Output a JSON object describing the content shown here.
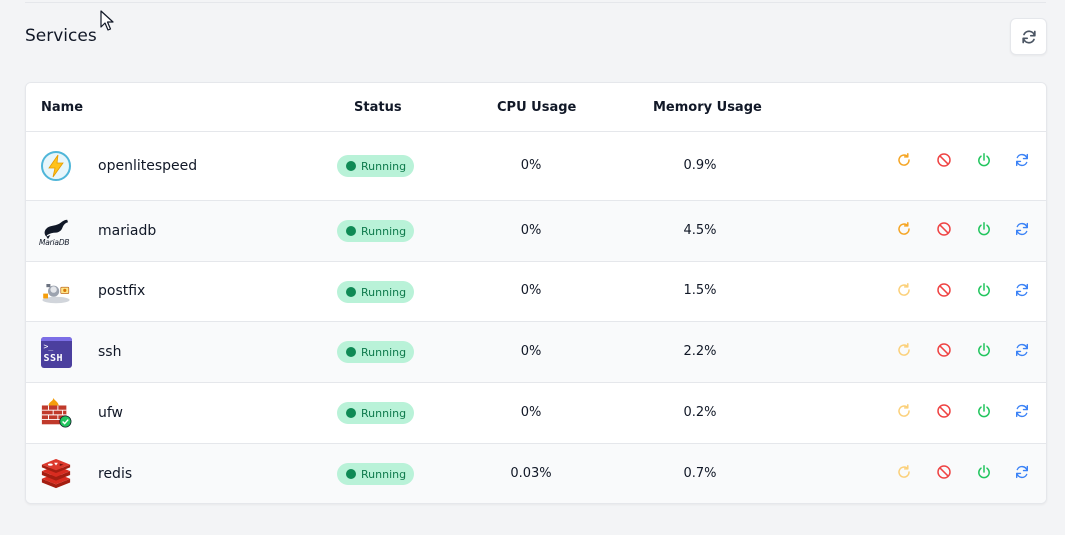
{
  "page": {
    "title": "Services"
  },
  "table": {
    "headers": {
      "name": "Name",
      "status": "Status",
      "cpu": "CPU Usage",
      "memory": "Memory Usage"
    },
    "rows": [
      {
        "icon": "openlitespeed-logo",
        "name": "openlitespeed",
        "status": "Running",
        "cpu": "0%",
        "memory": "0.9%"
      },
      {
        "icon": "mariadb-logo",
        "name": "mariadb",
        "status": "Running",
        "cpu": "0%",
        "memory": "4.5%",
        "logo_text": "MariaDB"
      },
      {
        "icon": "postfix-logo",
        "name": "postfix",
        "status": "Running",
        "cpu": "0%",
        "memory": "1.5%"
      },
      {
        "icon": "ssh-logo",
        "name": "ssh",
        "status": "Running",
        "cpu": "0%",
        "memory": "2.2%",
        "logo_text": "SSH"
      },
      {
        "icon": "ufw-logo",
        "name": "ufw",
        "status": "Running",
        "cpu": "0%",
        "memory": "0.2%"
      },
      {
        "icon": "redis-logo",
        "name": "redis",
        "status": "Running",
        "cpu": "0.03%",
        "memory": "0.7%"
      }
    ]
  },
  "colors": {
    "restart": "#f59e0b",
    "stop": "#ef4444",
    "start": "#22c55e",
    "reload": "#3b82f6",
    "badge_bg": "#b9f2d8",
    "badge_text": "#0e7a4c"
  }
}
